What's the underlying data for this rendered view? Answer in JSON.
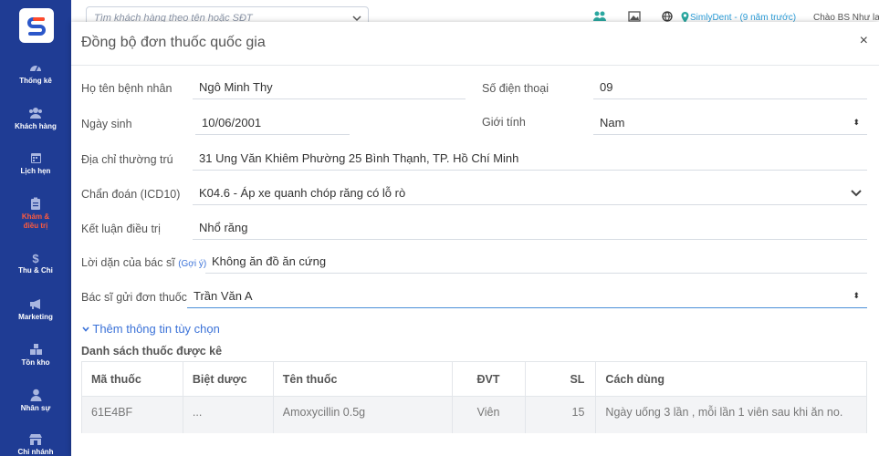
{
  "sidebar": {
    "logo_letter": "S",
    "items": [
      {
        "label": "Thống kê",
        "icon": "dashboard-icon"
      },
      {
        "label": "Khách hàng",
        "icon": "users-icon"
      },
      {
        "label": "Lịch hẹn",
        "icon": "calendar-icon"
      },
      {
        "label": "Khám & điều trị",
        "icon": "clipboard-icon",
        "active": true
      },
      {
        "label": "Thu & Chi",
        "icon": "dollar-icon"
      },
      {
        "label": "Marketing",
        "icon": "megaphone-icon"
      },
      {
        "label": "Tồn kho",
        "icon": "boxes-icon"
      },
      {
        "label": "Nhân sự",
        "icon": "person-icon"
      },
      {
        "label": "Chi nhánh",
        "icon": "store-icon"
      }
    ]
  },
  "topbar": {
    "search_placeholder": "Tìm khách hàng theo tên hoặc SĐT",
    "branch": "SimlyDent - (9 năm trước)",
    "greeting": "Chào BS Như lan"
  },
  "modal": {
    "title": "Đồng bộ đơn thuốc quốc gia",
    "close": "×",
    "fields": {
      "name_label": "Họ tên bệnh nhân",
      "name_value": "Ngô Minh Thy",
      "phone_label": "Số điện thoại",
      "phone_value": "09",
      "dob_label": "Ngày sinh",
      "dob_value": "10/06/2001",
      "gender_label": "Giới tính",
      "gender_value": "Nam",
      "address_label": "Địa chỉ thường trú",
      "address_value": "31 Ung Văn Khiêm Phường 25 Bình Thạnh, TP. Hồ Chí Minh",
      "diagnosis_label": "Chẩn đoán (ICD10)",
      "diagnosis_value": "K04.6 - Áp xe quanh chóp răng có lỗ rò",
      "conclusion_label": "Kết luận điều trị",
      "conclusion_value": "Nhổ răng",
      "advice_label": "Lời dặn của bác sĩ",
      "advice_hint": "(Gợi ý)",
      "advice_value": "Không ăn đồ ăn cứng",
      "doctor_label": "Bác sĩ gửi đơn thuốc",
      "doctor_value": "Trần Văn A"
    },
    "more_options": "Thêm thông tin tùy chọn",
    "drug_list_title": "Danh sách thuốc được kê",
    "table": {
      "headers": [
        "Mã thuốc",
        "Biệt dược",
        "Tên thuốc",
        "ĐVT",
        "SL",
        "Cách dùng"
      ],
      "rows": [
        [
          "61E4BF",
          "...",
          "Amoxycillin 0.5g",
          "Viên",
          "15",
          "Ngày uống 3 lần , mỗi lần 1 viên sau khi ăn no."
        ]
      ]
    }
  },
  "colors": {
    "sidebar": "#1f3c94",
    "accent": "#3b72d8",
    "active": "#ff5a3c"
  }
}
